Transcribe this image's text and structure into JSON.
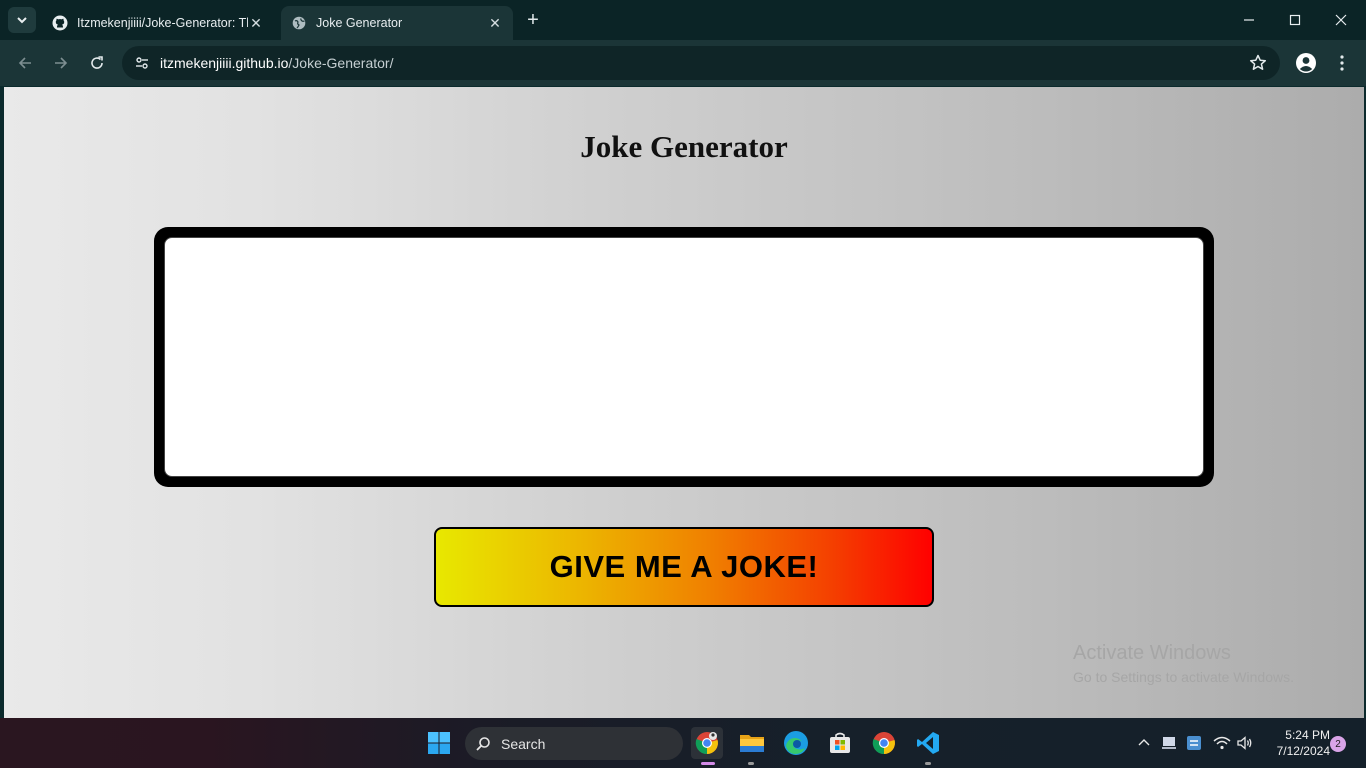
{
  "browser": {
    "tabs": [
      {
        "title": "Itzmekenjiiii/Joke-Generator: Th",
        "active": false,
        "favicon": "github-icon"
      },
      {
        "title": "Joke Generator",
        "active": true,
        "favicon": "globe-icon"
      }
    ],
    "url_host": "itzmekenjiiii.github.io",
    "url_path": "/Joke-Generator/"
  },
  "page": {
    "title": "Joke Generator",
    "joke_text": "",
    "button_label": "GIVE ME A JOKE!"
  },
  "watermark": {
    "line1": "Activate Windows",
    "line2": "Go to Settings to activate Windows."
  },
  "taskbar": {
    "search_label": "Search",
    "time": "5:24 PM",
    "date": "7/12/2024",
    "notification_count": "2",
    "pinned_apps": [
      "windows-start-icon",
      "chrome-profile-icon",
      "file-explorer-icon",
      "edge-icon",
      "microsoft-store-icon",
      "chrome-icon",
      "vscode-icon"
    ]
  },
  "colors": {
    "button_gradient_start": "#e8e800",
    "button_gradient_end": "#ff0000",
    "browser_frame": "#0b2426",
    "toolbar": "#1b3537"
  }
}
